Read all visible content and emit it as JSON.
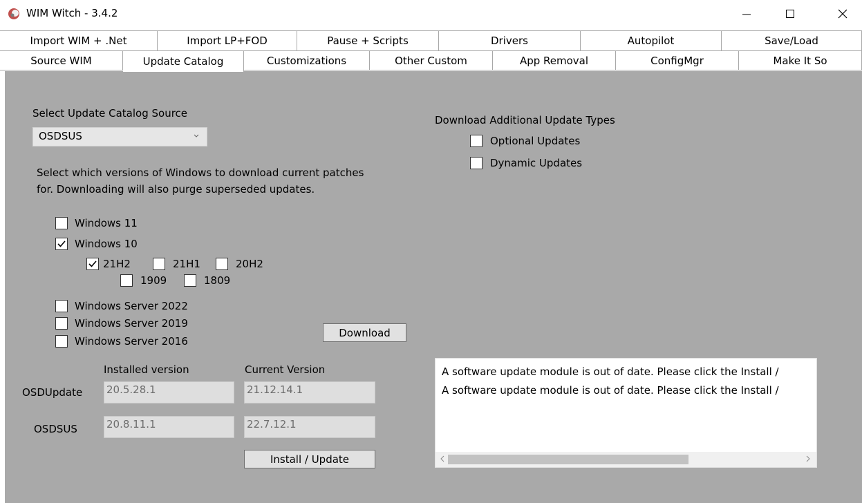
{
  "window": {
    "title": "WIM Witch - 3.4.2",
    "minimize_glyph": "—",
    "close_glyph": "✕",
    "icon": "wim-witch-app-icon"
  },
  "tabs_row1": [
    {
      "label": "Import WIM + .Net"
    },
    {
      "label": "Import LP+FOD"
    },
    {
      "label": "Pause + Scripts"
    },
    {
      "label": "Drivers"
    },
    {
      "label": "Autopilot"
    },
    {
      "label": "Save/Load"
    }
  ],
  "tabs_row2": [
    {
      "label": "Source WIM"
    },
    {
      "label": "Update Catalog",
      "active": true
    },
    {
      "label": "Customizations"
    },
    {
      "label": "Other Custom"
    },
    {
      "label": "App Removal"
    },
    {
      "label": "ConfigMgr"
    },
    {
      "label": "Make It So"
    }
  ],
  "catalog": {
    "source_label": "Select Update Catalog Source",
    "source_value": "OSDSUS",
    "instructions_line1": "Select which versions of Windows to download current patches",
    "instructions_line2": "for. Downloading will also purge superseded updates."
  },
  "versions": {
    "win11": {
      "label": "Windows 11",
      "checked": false
    },
    "win10": {
      "label": "Windows 10",
      "checked": true
    },
    "b21h2": {
      "label": "21H2",
      "checked": true
    },
    "b21h1": {
      "label": "21H1",
      "checked": false
    },
    "b20h2": {
      "label": "20H2",
      "checked": false
    },
    "b1909": {
      "label": "1909",
      "checked": false
    },
    "b1809": {
      "label": "1809",
      "checked": false
    },
    "srv2022": {
      "label": "Windows Server 2022",
      "checked": false
    },
    "srv2019": {
      "label": "Windows Server 2019",
      "checked": false
    },
    "srv2016": {
      "label": "Windows Server 2016",
      "checked": false
    }
  },
  "download_button": "Download",
  "additional": {
    "heading": "Download Additional Update Types",
    "optional": {
      "label": "Optional Updates",
      "checked": false
    },
    "dynamic": {
      "label": "Dynamic Updates",
      "checked": false
    }
  },
  "modules": {
    "installed_header": "Installed version",
    "current_header": "Current Version",
    "osdupdate": {
      "name": "OSDUpdate",
      "installed": "20.5.28.1",
      "current": "21.12.14.1"
    },
    "osdsus": {
      "name": "OSDSUS",
      "installed": "20.8.11.1",
      "current": "22.7.12.1"
    },
    "install_button": "Install / Update"
  },
  "log": {
    "lines": [
      "A software update module is out of date. Please click the Install /",
      "A software update module is out of date. Please click the Install /"
    ]
  },
  "colors": {
    "panel_bg": "#a9a9a9",
    "tab_border": "#a8a8a8",
    "textbox_bg": "#dedede"
  }
}
